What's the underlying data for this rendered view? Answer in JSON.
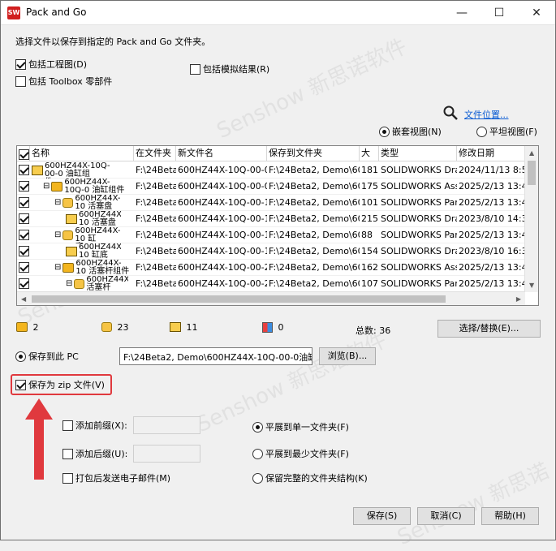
{
  "window": {
    "title": "Pack and Go",
    "app_icon_text": "SW",
    "controls": {
      "minimize": "—",
      "maximize": "☐",
      "close": "✕"
    }
  },
  "instruction": "选择文件以保存到指定的 Pack and Go 文件夹。",
  "options": {
    "include_drawings": {
      "label": "包括工程图(D)",
      "checked": true
    },
    "include_toolbox": {
      "label": "包括 Toolbox 零部件",
      "checked": false
    },
    "include_simulation": {
      "label": "包括模拟结果(R)",
      "checked": false
    }
  },
  "file_location_link": "文件位置...",
  "view_mode": {
    "nested": {
      "label": "嵌套视图(N)",
      "checked": true
    },
    "flat": {
      "label": "平坦视图(F)",
      "checked": false
    }
  },
  "table": {
    "columns": [
      "名称",
      "在文件夹",
      "新文件名",
      "保存到文件夹",
      "大",
      "类型",
      "修改日期"
    ],
    "rows": [
      {
        "checked": true,
        "level": 0,
        "expander": "",
        "icon": "drawing",
        "name": "600HZ44X-10Q-00-0 油缸组件.SLDDRW",
        "folder": "F:\\24Beta",
        "newname": "600HZ44X-10Q-00-0",
        "saveto": "F:\\24Beta2, Demo\\60",
        "size": "181",
        "type": "SOLIDWORKS Dra",
        "date": "2024/11/13 8:53"
      },
      {
        "checked": true,
        "level": 1,
        "expander": "⊟",
        "icon": "assembly",
        "name": "600HZ44X-10Q-0 油缸组件",
        "folder": "F:\\24Beta",
        "newname": "600HZ44X-10Q-00-0",
        "saveto": "F:\\24Beta2, Demo\\60",
        "size": "175",
        "type": "SOLIDWORKS Ass",
        "date": "2025/2/13 13:40"
      },
      {
        "checked": true,
        "level": 2,
        "expander": "⊟",
        "icon": "part",
        "name": "600HZ44X-10 活塞盘",
        "folder": "F:\\24Beta",
        "newname": "600HZ44X-10Q-00-10",
        "saveto": "F:\\24Beta2, Demo\\60",
        "size": "101",
        "type": "SOLIDWORKS Part",
        "date": "2025/2/13 13:40"
      },
      {
        "checked": true,
        "level": 3,
        "expander": "",
        "icon": "drawing",
        "name": "600HZ44X-10 活塞盘",
        "folder": "F:\\24Beta",
        "newname": "600HZ44X-10Q-00-10",
        "saveto": "F:\\24Beta2, Demo\\60",
        "size": "215",
        "type": "SOLIDWORKS Dra",
        "date": "2023/8/10 14:39"
      },
      {
        "checked": true,
        "level": 2,
        "expander": "⊟",
        "icon": "part",
        "name": "600HZ44X-10 缸底.SLDPRT",
        "folder": "F:\\24Beta",
        "newname": "600HZ44X-10Q-00-1",
        "saveto": "F:\\24Beta2, Demo\\60",
        "size": "88",
        "type": "SOLIDWORKS Part",
        "date": "2025/2/13 13:40"
      },
      {
        "checked": true,
        "level": 3,
        "expander": "",
        "icon": "drawing",
        "name": "600HZ44X-10 缸底",
        "folder": "F:\\24Beta",
        "newname": "600HZ44X-10Q-00-1",
        "saveto": "F:\\24Beta2, Demo\\60",
        "size": "154",
        "type": "SOLIDWORKS Dra",
        "date": "2023/8/10 16:31"
      },
      {
        "checked": true,
        "level": 2,
        "expander": "⊟",
        "icon": "assembly",
        "name": "600HZ44X-10 活塞杆组件",
        "folder": "F:\\24Beta",
        "newname": "600HZ44X-10Q-00-2",
        "saveto": "F:\\24Beta2, Demo\\60",
        "size": "162",
        "type": "SOLIDWORKS Ass",
        "date": "2025/2/13 13:40"
      },
      {
        "checked": true,
        "level": 3,
        "expander": "⊟",
        "icon": "part",
        "name": "600HZ44X- 活塞杆",
        "folder": "F:\\24Beta",
        "newname": "600HZ44X-10Q-00-2-",
        "saveto": "F:\\24Beta2, Demo\\60",
        "size": "107",
        "type": "SOLIDWORKS Part",
        "date": "2025/2/13 13:40"
      }
    ]
  },
  "summary": {
    "assemblies": "2",
    "parts": "23",
    "drawings": "11",
    "others": "0",
    "total_label": "总数: 36"
  },
  "select_replace_button": "选择/替换(E)...",
  "save_to_pc": {
    "label": "保存到此 PC",
    "checked": true,
    "path": "F:\\24Beta2, Demo\\600HZ44X-10Q-00-0油缸组"
  },
  "browse_button": "浏览(B)...",
  "save_as_zip": {
    "label": "保存为 zip 文件(V)",
    "checked": true
  },
  "prefix": {
    "label": "添加前缀(X):",
    "checked": false,
    "value": ""
  },
  "suffix": {
    "label": "添加后缀(U):",
    "checked": false,
    "value": ""
  },
  "send_email": {
    "label": "打包后发送电子邮件(M)",
    "checked": false
  },
  "structure": {
    "flatten_single": {
      "label": "平展到单一文件夹(F)",
      "checked": true
    },
    "flatten_fewest": {
      "label": "平展到最少文件夹(F)",
      "checked": false
    },
    "keep_full": {
      "label": "保留完整的文件夹结构(K)",
      "checked": false
    }
  },
  "buttons": {
    "save": "保存(S)",
    "cancel": "取消(C)",
    "help": "帮助(H)"
  },
  "colors": {
    "highlight_red": "#e0393e",
    "link_blue": "#0a5bd3",
    "icon_yellow": "#f3b51e"
  }
}
